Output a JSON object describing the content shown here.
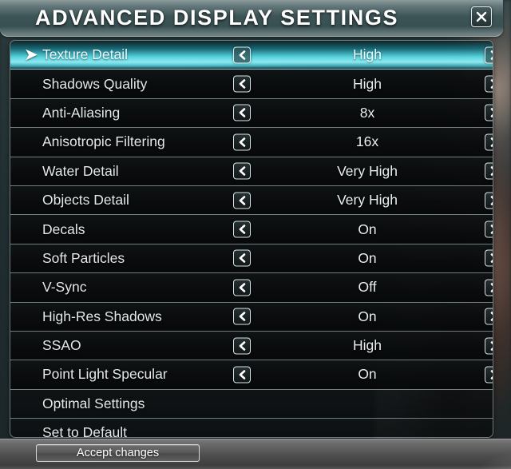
{
  "window": {
    "title": "ADVANCED DISPLAY SETTINGS",
    "close_icon": "close-x-icon",
    "accent_cyan": "#5ce2ee",
    "panel_bg": "#0d0f10",
    "titlebar_color": "#3e5658"
  },
  "list": {
    "selected_index": 0,
    "selection_pointer": "➤",
    "left_arrow_icon": "chevron-left-icon",
    "right_arrow_icon": "chevron-right-icon",
    "items": [
      {
        "label": "Texture Detail",
        "value": "High",
        "has_arrows": true,
        "selected": true
      },
      {
        "label": "Shadows Quality",
        "value": "High",
        "has_arrows": true,
        "selected": false
      },
      {
        "label": "Anti-Aliasing",
        "value": "8x",
        "has_arrows": true,
        "selected": false
      },
      {
        "label": "Anisotropic Filtering",
        "value": "16x",
        "has_arrows": true,
        "selected": false
      },
      {
        "label": "Water Detail",
        "value": "Very High",
        "has_arrows": true,
        "selected": false
      },
      {
        "label": "Objects Detail",
        "value": "Very High",
        "has_arrows": true,
        "selected": false
      },
      {
        "label": "Decals",
        "value": "On",
        "has_arrows": true,
        "selected": false
      },
      {
        "label": "Soft Particles",
        "value": "On",
        "has_arrows": true,
        "selected": false
      },
      {
        "label": "V-Sync",
        "value": "Off",
        "has_arrows": true,
        "selected": false
      },
      {
        "label": "High-Res Shadows",
        "value": "On",
        "has_arrows": true,
        "selected": false
      },
      {
        "label": "SSAO",
        "value": "High",
        "has_arrows": true,
        "selected": false
      },
      {
        "label": "Point Light Specular",
        "value": "On",
        "has_arrows": true,
        "selected": false
      },
      {
        "label": "Optimal Settings",
        "value": "",
        "has_arrows": false,
        "selected": false
      },
      {
        "label": "Set to Default",
        "value": "",
        "has_arrows": false,
        "selected": false
      }
    ]
  },
  "footer": {
    "accept_label": "Accept changes"
  }
}
